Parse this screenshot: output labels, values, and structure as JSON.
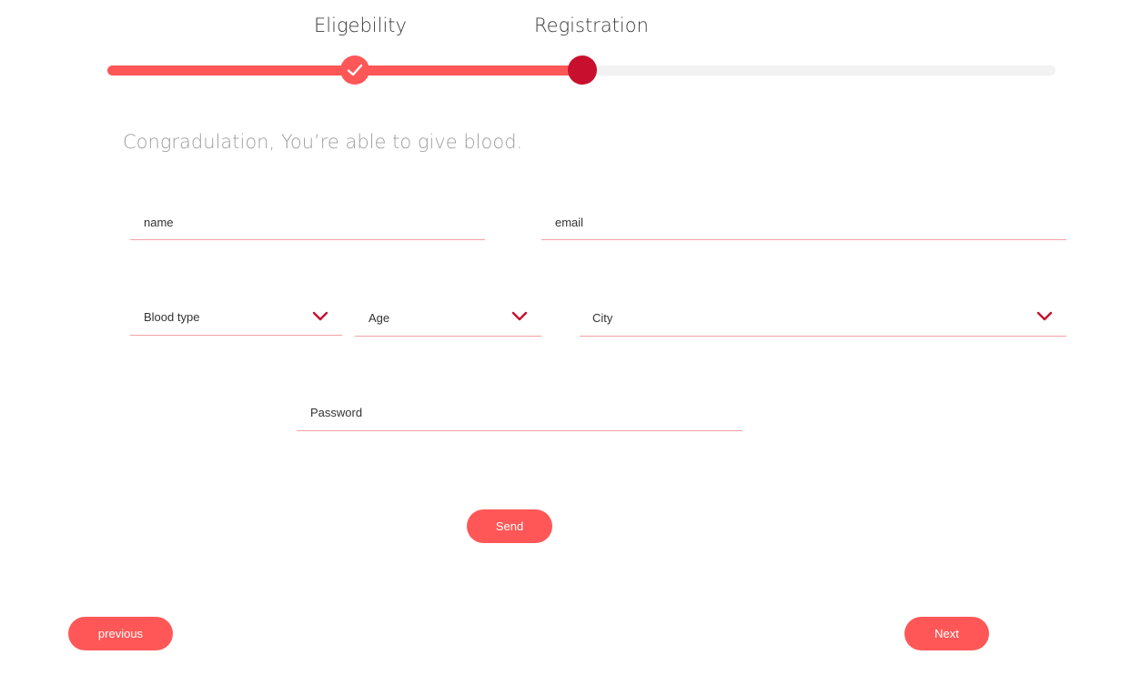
{
  "colors": {
    "accent": "#ff5757",
    "accent_dark": "#c8102e",
    "track": "#f2f2f2",
    "underline": "#f3a1a6",
    "headline": "#9e9e9e"
  },
  "stepper": {
    "progress": 0.5,
    "steps": [
      {
        "label": "Eligebility",
        "state": "completed",
        "icon": "check-icon"
      },
      {
        "label": "Registration",
        "state": "current"
      }
    ]
  },
  "headline": "Congradulation, You’re able to give blood.",
  "form": {
    "name": {
      "placeholder": "name"
    },
    "email": {
      "placeholder": "email"
    },
    "blood_type": {
      "placeholder": "Blood type",
      "icon": "chevron-down-icon"
    },
    "age": {
      "placeholder": "Age",
      "icon": "chevron-down-icon"
    },
    "city": {
      "placeholder": "City",
      "icon": "chevron-down-icon"
    },
    "password": {
      "placeholder": "Password"
    },
    "send_label": "Send"
  },
  "nav": {
    "previous_label": "previous",
    "next_label": "Next"
  }
}
